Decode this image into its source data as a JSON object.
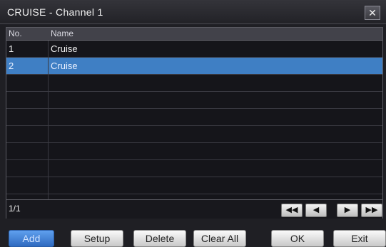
{
  "window": {
    "title": "CRUISE - Channel 1",
    "close_glyph": "✕"
  },
  "table": {
    "headers": {
      "no": "No.",
      "name": "Name"
    },
    "rows": [
      {
        "no": "1",
        "name": "Cruise"
      },
      {
        "no": "2",
        "name": "Cruise"
      }
    ],
    "selected_index": 1
  },
  "pagination": {
    "indicator": "1/1",
    "first_glyph": "◀◀",
    "prev_glyph": "◀",
    "next_glyph": "▶",
    "last_glyph": "▶▶"
  },
  "buttons": {
    "add": "Add",
    "setup": "Setup",
    "delete": "Delete",
    "clear_all": "Clear All",
    "ok": "OK",
    "exit": "Exit"
  },
  "colors": {
    "selection": "#3f7fc4",
    "primary_button": "#3f7fd0"
  }
}
